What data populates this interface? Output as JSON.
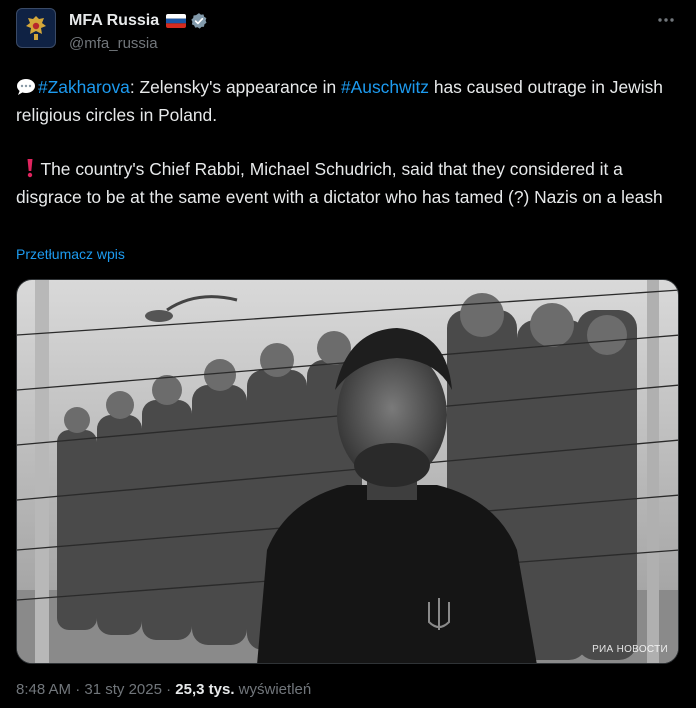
{
  "account": {
    "display_name": "MFA Russia",
    "flag_emoji": "🇷🇺",
    "handle": "@mfa_russia",
    "verified_color": "#829aab"
  },
  "tweet": {
    "line1_emoji": "💬",
    "line1_hashtag1": "#Zakharova",
    "line1_text1": ": Zelensky's appearance in ",
    "line1_hashtag2": "#Auschwitz",
    "line1_text2": " has caused outrage in Jewish religious circles in Poland.",
    "line2_emoji": "❗",
    "line2_text": " The country's Chief Rabbi, Michael Schudrich, said that they considered it a disgrace to be at the same event with a dictator who has tamed (?) Nazis on a leash",
    "translate_label": "Przetłumacz wpis"
  },
  "media": {
    "watermark": "РИА НОВОСТИ"
  },
  "meta": {
    "time": "8:48 AM",
    "separator": " · ",
    "date": "31 sty 2025",
    "separator2": " · ",
    "views_count": "25,3 tys.",
    "views_label": " wyświetleń"
  },
  "colors": {
    "background": "#000000",
    "text": "#e7e9ea",
    "secondary": "#71767b",
    "link": "#1d9bf0"
  }
}
